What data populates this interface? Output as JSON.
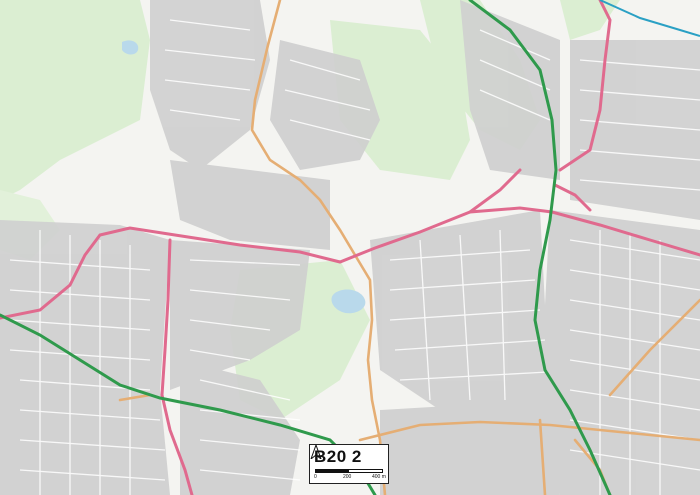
{
  "map": {
    "postcode_label": "B20 2",
    "north_label": "A",
    "scale": {
      "start": "0",
      "mid": "200",
      "end": "400 m"
    },
    "colors": {
      "background": "#f4f4f1",
      "green_area": "#d9ecd0",
      "water": "#b8d8ea",
      "building": "#d0d0d0",
      "motorway": "#2f9a4c",
      "primary_road": "#e2688c",
      "secondary_road": "#e4ad72",
      "railway": "#2aa0c4"
    }
  }
}
